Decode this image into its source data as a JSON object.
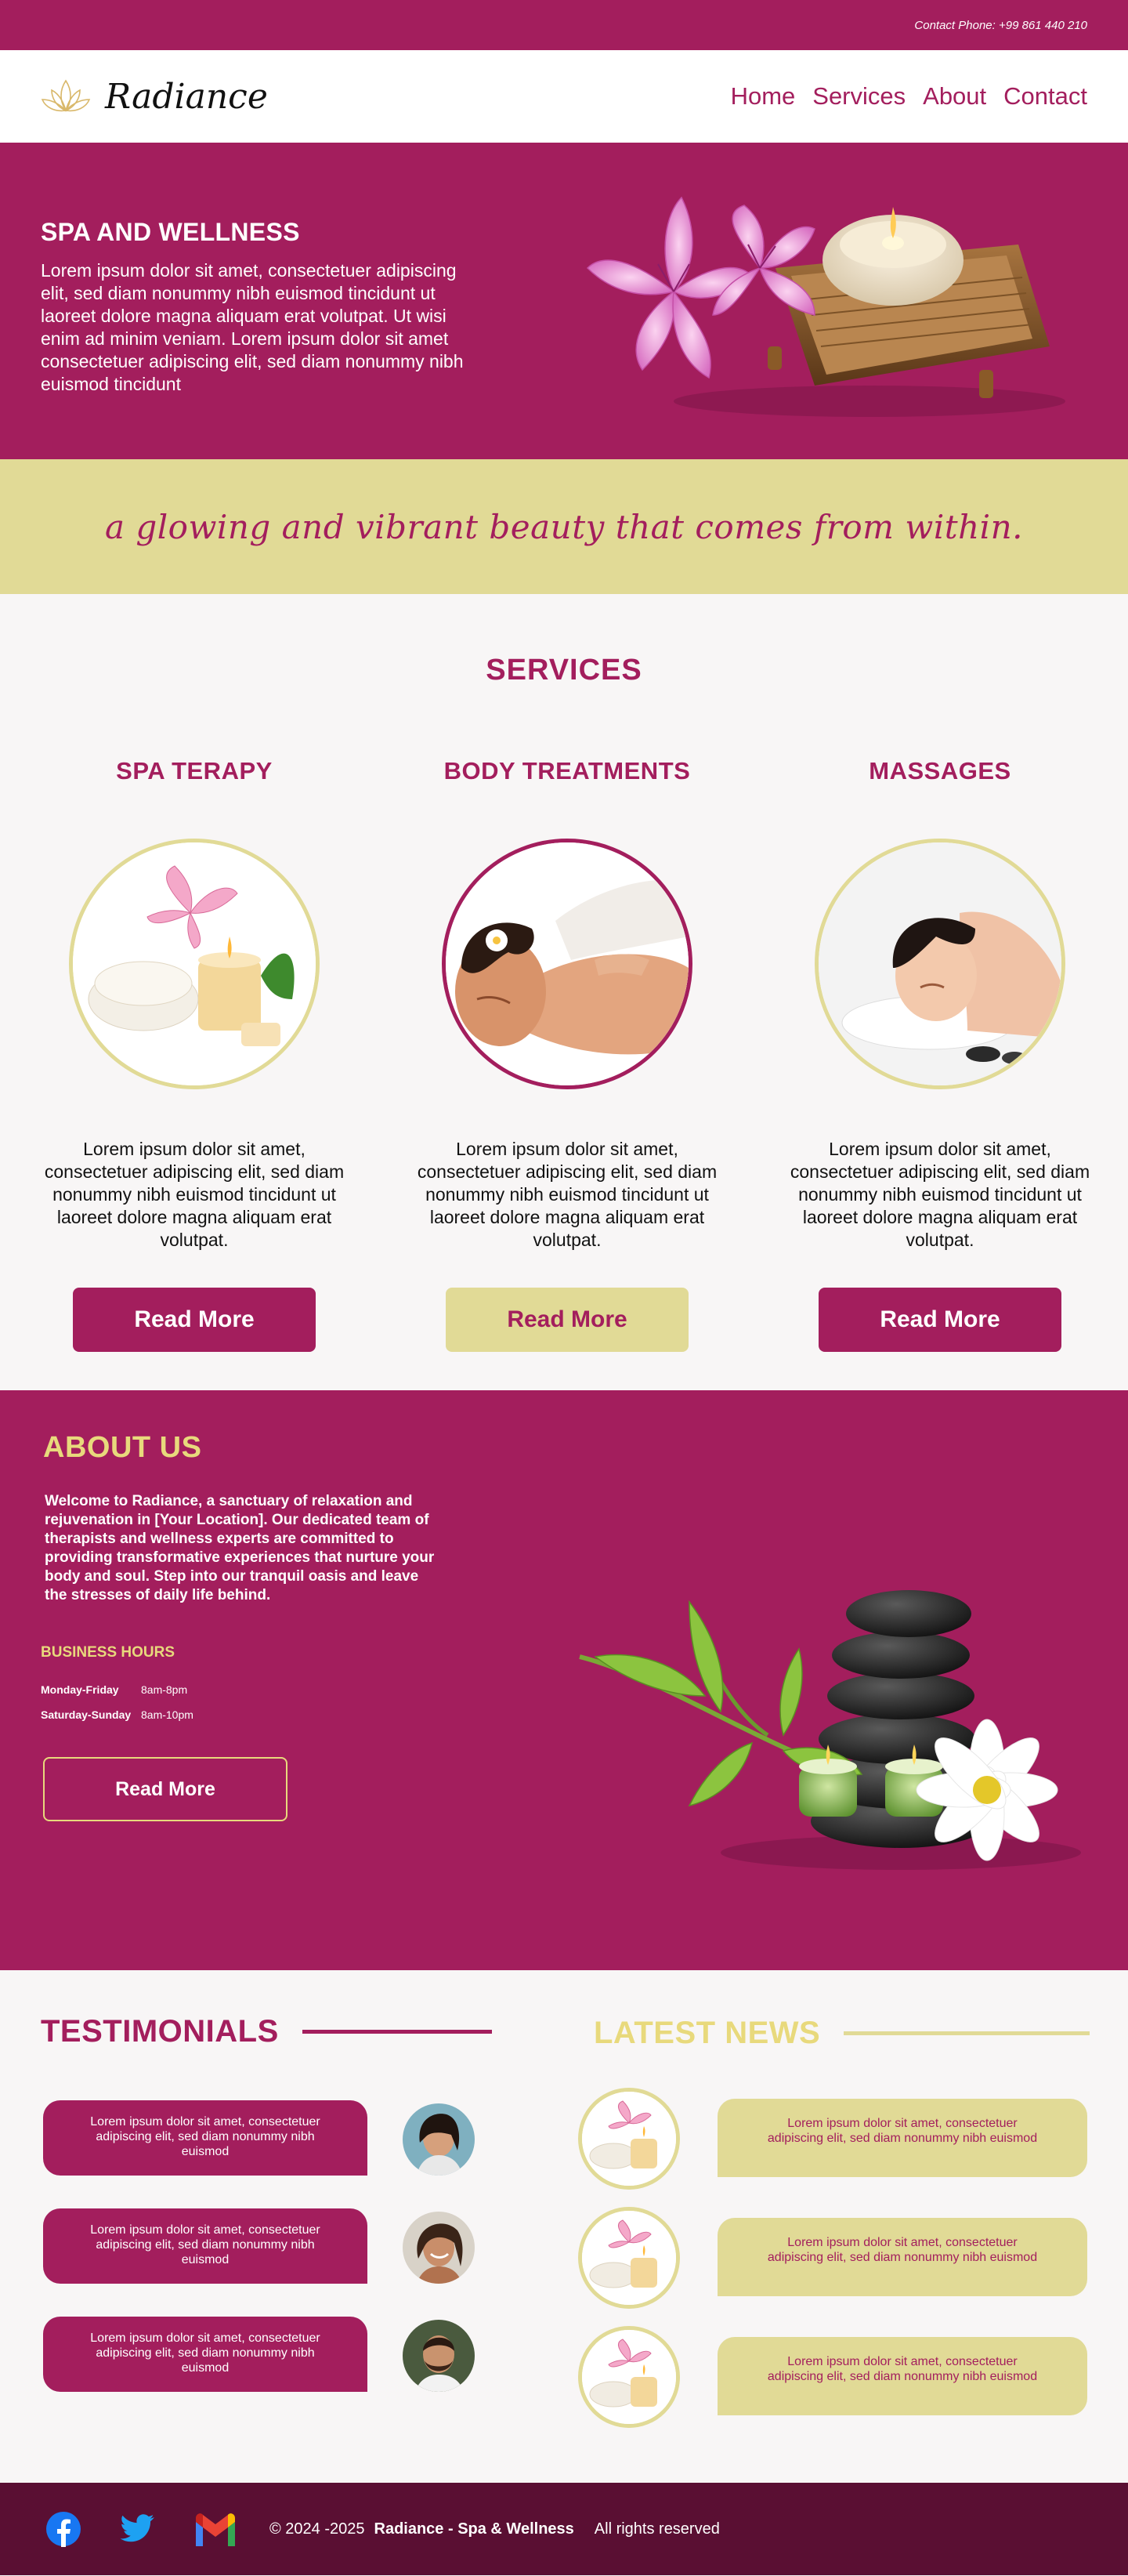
{
  "topbar": {
    "contact": "Contact Phone: +99 861 440 210"
  },
  "header": {
    "logo_text": "Radiance",
    "logo_icon": "lotus-icon",
    "nav": [
      "Home",
      "Services",
      "About",
      "Contact"
    ]
  },
  "hero": {
    "title": "SPA AND WELLNESS",
    "body": "Lorem ipsum dolor sit amet, consectetuer adipiscing elit, sed diam nonummy nibh euismod tincidunt ut laoreet dolore magna aliquam erat volutpat. Ut wisi enim ad minim veniam. Lorem ipsum dolor sit amet consectetuer adipiscing elit, sed diam nonummy nibh euismod tincidunt"
  },
  "tagline": "a glowing and vibrant beauty that comes from within.",
  "services": {
    "title": "SERVICES",
    "items": [
      {
        "title": "SPA TERAPY",
        "text": "Lorem ipsum dolor sit amet, consectetuer adipiscing elit, sed diam nonummy nibh euismod tincidunt ut laoreet dolore magna aliquam erat volutpat.",
        "button": "Read More"
      },
      {
        "title": "BODY TREATMENTS",
        "text": "Lorem ipsum dolor sit amet, consectetuer adipiscing elit, sed diam nonummy nibh euismod tincidunt ut laoreet dolore magna aliquam erat volutpat.",
        "button": "Read More"
      },
      {
        "title": "MASSAGES",
        "text": "Lorem ipsum dolor sit amet, consectetuer adipiscing elit, sed diam nonummy nibh euismod tincidunt ut laoreet dolore magna aliquam erat volutpat.",
        "button": "Read More"
      }
    ]
  },
  "about": {
    "title": "ABOUT US",
    "body": "Welcome to Radiance, a sanctuary of relaxation and rejuvenation in [Your Location]. Our dedicated team of therapists and wellness experts are committed to providing transformative experiences that nurture your body and soul. Step into our tranquil oasis and leave the stresses of daily life behind.",
    "hours_title": "BUSINESS HOURS",
    "hours": [
      {
        "day": "Monday-Friday",
        "time": "8am-8pm"
      },
      {
        "day": "Saturday-Sunday",
        "time": "8am-10pm"
      }
    ],
    "button": "Read More"
  },
  "testimonials": {
    "title": "TESTIMONIALS",
    "items": [
      {
        "text": "Lorem ipsum dolor sit amet, consectetuer adipiscing elit, sed diam nonummy nibh euismod"
      },
      {
        "text": "Lorem ipsum dolor sit amet, consectetuer adipiscing elit, sed diam nonummy nibh euismod"
      },
      {
        "text": "Lorem ipsum dolor sit amet, consectetuer adipiscing elit, sed diam nonummy nibh euismod"
      }
    ]
  },
  "news": {
    "title": "LATEST NEWS",
    "items": [
      {
        "text": "Lorem ipsum dolor sit amet, consectetuer adipiscing elit, sed diam nonummy nibh euismod"
      },
      {
        "text": "Lorem ipsum dolor sit amet, consectetuer adipiscing elit, sed diam nonummy nibh euismod"
      },
      {
        "text": "Lorem ipsum dolor sit amet, consectetuer adipiscing elit, sed diam nonummy nibh euismod"
      }
    ]
  },
  "footer": {
    "copyright": "© 2024 -2025",
    "brand": "Radiance - Spa & Wellness",
    "rights": "All rights reserved",
    "social": [
      "facebook-icon",
      "twitter-icon",
      "gmail-icon"
    ]
  },
  "colors": {
    "primary": "#a31e5d",
    "gold": "#e1da96",
    "dark": "#5a0f33",
    "light": "#f8f6f6"
  }
}
